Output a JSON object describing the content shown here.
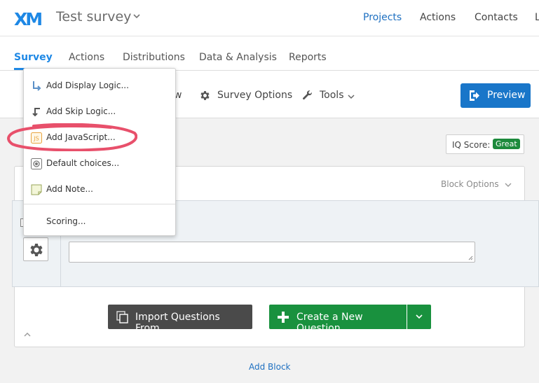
{
  "header": {
    "logo": "XM",
    "survey_title": "Test survey",
    "nav": [
      "Projects",
      "Actions",
      "Contacts",
      "L"
    ]
  },
  "subnav": {
    "tabs": [
      "Survey",
      "Actions",
      "Distributions",
      "Data & Analysis",
      "Reports"
    ],
    "active": "Survey"
  },
  "toolbar": {
    "partial_label": "w",
    "survey_options": "Survey Options",
    "tools": "Tools",
    "preview": "Preview"
  },
  "iq_score": {
    "label": "IQ Score:",
    "value": "Great"
  },
  "block": {
    "options_label": "Block Options",
    "import_label": "Import Questions From...",
    "create_label": "Create a New Question",
    "add_block": "Add Block"
  },
  "menu": {
    "items": [
      {
        "label": "Add Display Logic...",
        "icon": "display-logic-icon"
      },
      {
        "label": "Add Skip Logic...",
        "icon": "skip-logic-icon"
      },
      {
        "label": "Add JavaScript...",
        "icon": "javascript-icon",
        "icon_text": "JS"
      },
      {
        "label": "Default choices...",
        "icon": "default-choices-icon"
      },
      {
        "label": "Add Note...",
        "icon": "note-icon"
      },
      {
        "label": "Scoring...",
        "icon": ""
      }
    ]
  },
  "colors": {
    "accent": "#1e88e5",
    "primary_button": "#1976c9",
    "success": "#19913e",
    "dark_button": "#4a4a4a",
    "annotation": "#e8506b"
  }
}
